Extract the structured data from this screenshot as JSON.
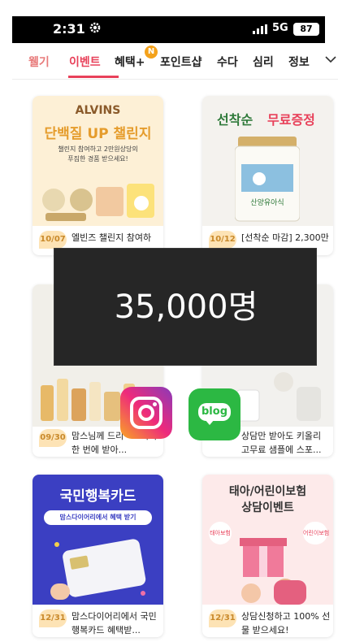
{
  "status_bar": {
    "time": "2:31",
    "network": "5G",
    "battery": "87"
  },
  "tabs": [
    {
      "label": "웰기"
    },
    {
      "label": "이벤트"
    },
    {
      "label": "혜택+"
    },
    {
      "label": "포인트샵"
    },
    {
      "label": "수다"
    },
    {
      "label": "심리"
    },
    {
      "label": "정보"
    }
  ],
  "tab_badge": "N",
  "colors": {
    "accent": "#e8415a",
    "date_badge_bg": "#fde3b5",
    "overlay_bg": "#262626",
    "blog_green": "#2cb843"
  },
  "cards": [
    {
      "date": "10/07",
      "title": "엘빈즈 챌린지 참여하",
      "image": {
        "brand": "ALVINS",
        "headline": "단백질 UP 챌린지",
        "sub1": "챌린지 참여하고 2만원상당의",
        "sub2": "푸짐한 경품 받으세요!"
      }
    },
    {
      "date": "10/12",
      "title": "[선착순 마감] 2,300만 ...",
      "image": {
        "headline_a": "선착순",
        "headline_b": "무료증정",
        "can_label": "산양유아식"
      }
    },
    {
      "date": "09/30",
      "title": "맘스님께 드리 ~! 터치 한 번에 받아..."
    },
    {
      "date": "",
      "title": "상담만 받아도 키올리 고무료 샘플에 스포..."
    },
    {
      "date": "12/31",
      "title": "맘스다이어리에서 국민행복카드 혜택받...",
      "image": {
        "headline": "국민행복카드",
        "ribbon": "맘스다이어리에서 혜택 받기"
      }
    },
    {
      "date": "12/31",
      "title": "상담신청하고 100% 선물 받으세요!",
      "image": {
        "headline1": "태아/어린이보험",
        "headline2": "상담이벤트",
        "tag_left": "태아보험",
        "tag_right": "어린이보험"
      }
    }
  ],
  "overlay": {
    "text": "35,000명"
  },
  "icons": {
    "instagram": "instagram-icon",
    "blog": "blog-icon",
    "blog_text": "blog"
  }
}
